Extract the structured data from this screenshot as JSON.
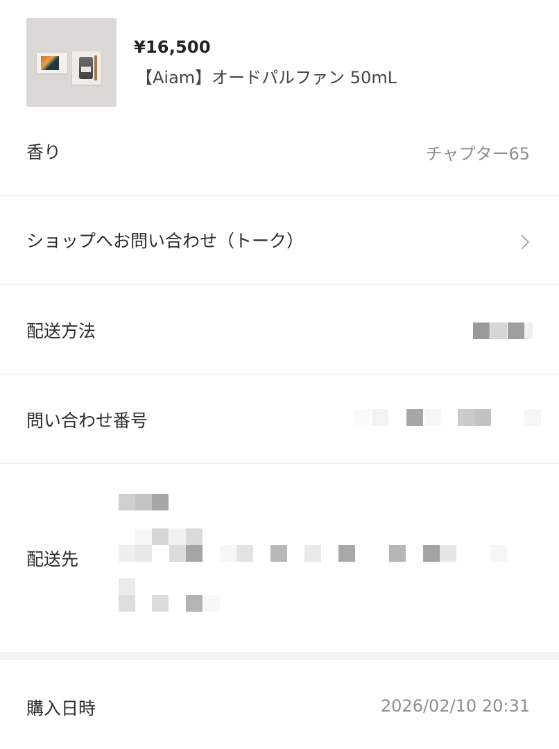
{
  "product": {
    "price": "¥16,500",
    "name": "【Aiam】オードパルファン 50mL"
  },
  "rows": {
    "scent": {
      "label": "香り",
      "value": "チャプター65"
    },
    "contact_shop": {
      "label": "ショップへお問い合わせ（トーク）"
    },
    "shipping_method": {
      "label": "配送方法"
    },
    "inquiry_number": {
      "label": "問い合わせ番号"
    },
    "ship_to": {
      "label": "配送先"
    },
    "purchase_date": {
      "label": "購入日時",
      "value": "2026/02/10 20:31"
    }
  },
  "icons": {
    "contact_chevron": "chevron-right-icon"
  }
}
